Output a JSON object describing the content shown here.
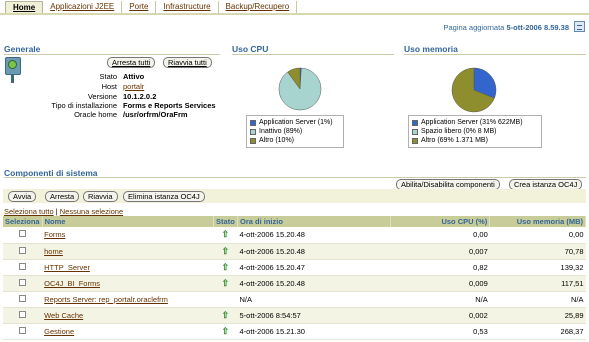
{
  "tabs": [
    {
      "label": "Home",
      "active": true
    },
    {
      "label": "Applicazioni J2EE",
      "active": false
    },
    {
      "label": "Porte",
      "active": false
    },
    {
      "label": "Infrastructure",
      "active": false
    },
    {
      "label": "Backup/Recupero",
      "active": false
    }
  ],
  "page_updated": {
    "label": "Pagina aggiornata",
    "value": "5-ott-2006 8.59.38"
  },
  "general": {
    "title": "Generale",
    "stop_all": "Arresta tutti",
    "restart_all": "Riavvia tutti",
    "fields": [
      {
        "label": "Stato",
        "value": "Attivo"
      },
      {
        "label": "Host",
        "value": "portalr"
      },
      {
        "label": "Versione",
        "value": "10.1.2.0.2"
      },
      {
        "label": "Tipo di installazione",
        "value": "Forms e Reports Services"
      },
      {
        "label": "Oracle home",
        "value": "/usr/orfrm/OraFrm"
      }
    ]
  },
  "cpu": {
    "title": "Uso CPU",
    "legend": [
      {
        "label": "Application Server (1%)",
        "color": "#3366cc",
        "percent": 1
      },
      {
        "label": "Inattivo (89%)",
        "color": "#a8d4d0",
        "percent": 89
      },
      {
        "label": "Altro (10%)",
        "color": "#8e8e2e",
        "percent": 10
      }
    ]
  },
  "memory": {
    "title": "Uso memoria",
    "legend": [
      {
        "label": "Application Server (31% 622MB)",
        "color": "#3366cc",
        "percent": 31
      },
      {
        "label": "Spazio libero (0% 8 MB)",
        "color": "#a8d4d0",
        "percent": 0
      },
      {
        "label": "Altro (69% 1.371 MB)",
        "color": "#8e8e2e",
        "percent": 69
      }
    ]
  },
  "components": {
    "title": "Componenti di sistema",
    "enable_disable": "Abilita/Disabilita componenti",
    "create_instance": "Crea istanza OC4J",
    "actions": {
      "start": "Avvia",
      "stop": "Arresta",
      "restart": "Riavvia",
      "delete": "Elimina istanza OC4J"
    },
    "select_all": "Seleziona tutto",
    "select_none": "Nessuna selezione",
    "columns": [
      "Seleziona",
      "Nome",
      "Stato",
      "Ora di inizio",
      "Uso CPU (%)",
      "Uso memoria (MB)"
    ],
    "rows": [
      {
        "name": "Forms",
        "status": "up",
        "start": "4-ott-2006 15.20.48",
        "cpu": "0,00",
        "mem": "0,00"
      },
      {
        "name": "home",
        "status": "up",
        "start": "4-ott-2006 15.20.48",
        "cpu": "0,007",
        "mem": "70,78"
      },
      {
        "name": "HTTP_Server",
        "status": "up",
        "start": "4-ott-2006 15.20.47",
        "cpu": "0,82",
        "mem": "139,32"
      },
      {
        "name": "OC4J_BI_Forms",
        "status": "up",
        "start": "4-ott-2006 15.20.48",
        "cpu": "0,009",
        "mem": "117,51"
      },
      {
        "name": "Reports Server: rep_portalr.oraclefrm",
        "status": "",
        "start": "N/A",
        "cpu": "N/A",
        "mem": "N/A"
      },
      {
        "name": "Web Cache",
        "status": "up",
        "start": "5-ott-2006 8:54:57",
        "cpu": "0,002",
        "mem": "25,89"
      },
      {
        "name": "Gestione",
        "status": "up",
        "start": "4-ott-2006 15.21.30",
        "cpu": "0,53",
        "mem": "268,37"
      }
    ]
  }
}
